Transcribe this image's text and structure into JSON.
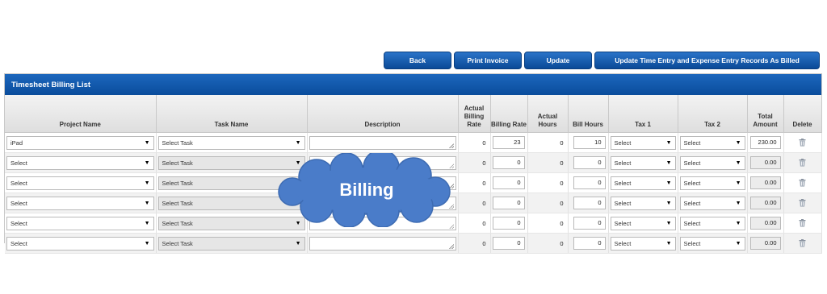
{
  "toolbar": {
    "back_label": "Back",
    "print_invoice_label": "Print Invoice",
    "update_label": "Update",
    "update_billed_label": "Update Time Entry and Expense Entry Records As Billed"
  },
  "panel": {
    "title": "Timesheet Billing List"
  },
  "columns": {
    "project": "Project Name",
    "task": "Task Name",
    "description": "Description",
    "actual_rate": "Actual Billing Rate",
    "billing_rate": "Billing Rate",
    "actual_hours": "Actual Hours",
    "bill_hours": "Bill Hours",
    "tax1": "Tax 1",
    "tax2": "Tax 2",
    "total_amount": "Total Amount",
    "delete": "Delete"
  },
  "rows": [
    {
      "project": "iPad",
      "task": "Select Task",
      "actual_rate": "0",
      "billing_rate": "23",
      "actual_hours": "0",
      "bill_hours": "10",
      "tax1": "Select",
      "tax2": "Select",
      "total": "230.00"
    },
    {
      "project": "Select",
      "task": "Select Task",
      "actual_rate": "0",
      "billing_rate": "0",
      "actual_hours": "0",
      "bill_hours": "0",
      "tax1": "Select",
      "tax2": "Select",
      "total": "0.00"
    },
    {
      "project": "Select",
      "task": "Select Task",
      "actual_rate": "0",
      "billing_rate": "0",
      "actual_hours": "0",
      "bill_hours": "0",
      "tax1": "Select",
      "tax2": "Select",
      "total": "0.00"
    },
    {
      "project": "Select",
      "task": "Select Task",
      "actual_rate": "0",
      "billing_rate": "0",
      "actual_hours": "0",
      "bill_hours": "0",
      "tax1": "Select",
      "tax2": "Select",
      "total": "0.00"
    },
    {
      "project": "Select",
      "task": "Select Task",
      "actual_rate": "0",
      "billing_rate": "0",
      "actual_hours": "0",
      "bill_hours": "0",
      "tax1": "Select",
      "tax2": "Select",
      "total": "0.00"
    },
    {
      "project": "Select",
      "task": "Select Task",
      "actual_rate": "0",
      "billing_rate": "0",
      "actual_hours": "0",
      "bill_hours": "0",
      "tax1": "Select",
      "tax2": "Select",
      "total": "0.00"
    }
  ],
  "overlay": {
    "label": "Billing"
  },
  "icons": {
    "caret": "chevron-down-icon",
    "delete": "trash-icon",
    "resize": "resize-grip-icon"
  },
  "colors": {
    "header_blue": "#0a4d9c",
    "cloud_blue": "#4a7cc9"
  }
}
